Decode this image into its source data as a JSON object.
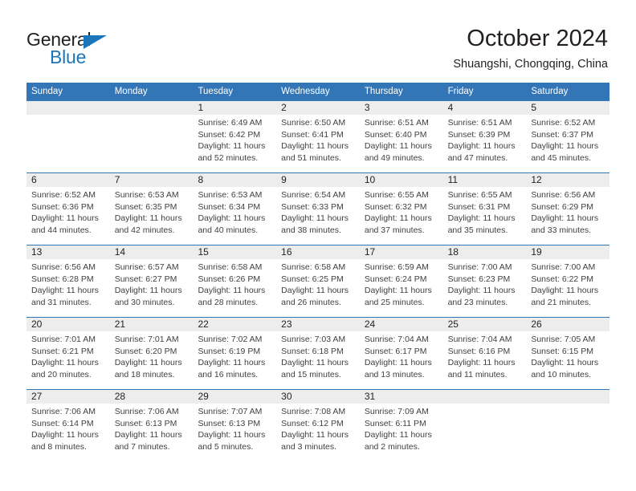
{
  "brand": {
    "name_top": "General",
    "name_bottom": "Blue",
    "color_blue": "#1b75bb",
    "color_dark": "#231f20"
  },
  "header": {
    "title": "October 2024",
    "subtitle": "Shuangshi, Chongqing, China"
  },
  "theme": {
    "header_blue": "#3276b8",
    "daynum_band": "#ededed",
    "text": "#231f20"
  },
  "weekdays": [
    "Sunday",
    "Monday",
    "Tuesday",
    "Wednesday",
    "Thursday",
    "Friday",
    "Saturday"
  ],
  "weeks": [
    [
      {
        "empty": true
      },
      {
        "empty": true
      },
      {
        "day": "1",
        "sunrise": "Sunrise: 6:49 AM",
        "sunset": "Sunset: 6:42 PM",
        "daylight1": "Daylight: 11 hours",
        "daylight2": "and 52 minutes."
      },
      {
        "day": "2",
        "sunrise": "Sunrise: 6:50 AM",
        "sunset": "Sunset: 6:41 PM",
        "daylight1": "Daylight: 11 hours",
        "daylight2": "and 51 minutes."
      },
      {
        "day": "3",
        "sunrise": "Sunrise: 6:51 AM",
        "sunset": "Sunset: 6:40 PM",
        "daylight1": "Daylight: 11 hours",
        "daylight2": "and 49 minutes."
      },
      {
        "day": "4",
        "sunrise": "Sunrise: 6:51 AM",
        "sunset": "Sunset: 6:39 PM",
        "daylight1": "Daylight: 11 hours",
        "daylight2": "and 47 minutes."
      },
      {
        "day": "5",
        "sunrise": "Sunrise: 6:52 AM",
        "sunset": "Sunset: 6:37 PM",
        "daylight1": "Daylight: 11 hours",
        "daylight2": "and 45 minutes."
      }
    ],
    [
      {
        "day": "6",
        "sunrise": "Sunrise: 6:52 AM",
        "sunset": "Sunset: 6:36 PM",
        "daylight1": "Daylight: 11 hours",
        "daylight2": "and 44 minutes."
      },
      {
        "day": "7",
        "sunrise": "Sunrise: 6:53 AM",
        "sunset": "Sunset: 6:35 PM",
        "daylight1": "Daylight: 11 hours",
        "daylight2": "and 42 minutes."
      },
      {
        "day": "8",
        "sunrise": "Sunrise: 6:53 AM",
        "sunset": "Sunset: 6:34 PM",
        "daylight1": "Daylight: 11 hours",
        "daylight2": "and 40 minutes."
      },
      {
        "day": "9",
        "sunrise": "Sunrise: 6:54 AM",
        "sunset": "Sunset: 6:33 PM",
        "daylight1": "Daylight: 11 hours",
        "daylight2": "and 38 minutes."
      },
      {
        "day": "10",
        "sunrise": "Sunrise: 6:55 AM",
        "sunset": "Sunset: 6:32 PM",
        "daylight1": "Daylight: 11 hours",
        "daylight2": "and 37 minutes."
      },
      {
        "day": "11",
        "sunrise": "Sunrise: 6:55 AM",
        "sunset": "Sunset: 6:31 PM",
        "daylight1": "Daylight: 11 hours",
        "daylight2": "and 35 minutes."
      },
      {
        "day": "12",
        "sunrise": "Sunrise: 6:56 AM",
        "sunset": "Sunset: 6:29 PM",
        "daylight1": "Daylight: 11 hours",
        "daylight2": "and 33 minutes."
      }
    ],
    [
      {
        "day": "13",
        "sunrise": "Sunrise: 6:56 AM",
        "sunset": "Sunset: 6:28 PM",
        "daylight1": "Daylight: 11 hours",
        "daylight2": "and 31 minutes."
      },
      {
        "day": "14",
        "sunrise": "Sunrise: 6:57 AM",
        "sunset": "Sunset: 6:27 PM",
        "daylight1": "Daylight: 11 hours",
        "daylight2": "and 30 minutes."
      },
      {
        "day": "15",
        "sunrise": "Sunrise: 6:58 AM",
        "sunset": "Sunset: 6:26 PM",
        "daylight1": "Daylight: 11 hours",
        "daylight2": "and 28 minutes."
      },
      {
        "day": "16",
        "sunrise": "Sunrise: 6:58 AM",
        "sunset": "Sunset: 6:25 PM",
        "daylight1": "Daylight: 11 hours",
        "daylight2": "and 26 minutes."
      },
      {
        "day": "17",
        "sunrise": "Sunrise: 6:59 AM",
        "sunset": "Sunset: 6:24 PM",
        "daylight1": "Daylight: 11 hours",
        "daylight2": "and 25 minutes."
      },
      {
        "day": "18",
        "sunrise": "Sunrise: 7:00 AM",
        "sunset": "Sunset: 6:23 PM",
        "daylight1": "Daylight: 11 hours",
        "daylight2": "and 23 minutes."
      },
      {
        "day": "19",
        "sunrise": "Sunrise: 7:00 AM",
        "sunset": "Sunset: 6:22 PM",
        "daylight1": "Daylight: 11 hours",
        "daylight2": "and 21 minutes."
      }
    ],
    [
      {
        "day": "20",
        "sunrise": "Sunrise: 7:01 AM",
        "sunset": "Sunset: 6:21 PM",
        "daylight1": "Daylight: 11 hours",
        "daylight2": "and 20 minutes."
      },
      {
        "day": "21",
        "sunrise": "Sunrise: 7:01 AM",
        "sunset": "Sunset: 6:20 PM",
        "daylight1": "Daylight: 11 hours",
        "daylight2": "and 18 minutes."
      },
      {
        "day": "22",
        "sunrise": "Sunrise: 7:02 AM",
        "sunset": "Sunset: 6:19 PM",
        "daylight1": "Daylight: 11 hours",
        "daylight2": "and 16 minutes."
      },
      {
        "day": "23",
        "sunrise": "Sunrise: 7:03 AM",
        "sunset": "Sunset: 6:18 PM",
        "daylight1": "Daylight: 11 hours",
        "daylight2": "and 15 minutes."
      },
      {
        "day": "24",
        "sunrise": "Sunrise: 7:04 AM",
        "sunset": "Sunset: 6:17 PM",
        "daylight1": "Daylight: 11 hours",
        "daylight2": "and 13 minutes."
      },
      {
        "day": "25",
        "sunrise": "Sunrise: 7:04 AM",
        "sunset": "Sunset: 6:16 PM",
        "daylight1": "Daylight: 11 hours",
        "daylight2": "and 11 minutes."
      },
      {
        "day": "26",
        "sunrise": "Sunrise: 7:05 AM",
        "sunset": "Sunset: 6:15 PM",
        "daylight1": "Daylight: 11 hours",
        "daylight2": "and 10 minutes."
      }
    ],
    [
      {
        "day": "27",
        "sunrise": "Sunrise: 7:06 AM",
        "sunset": "Sunset: 6:14 PM",
        "daylight1": "Daylight: 11 hours",
        "daylight2": "and 8 minutes."
      },
      {
        "day": "28",
        "sunrise": "Sunrise: 7:06 AM",
        "sunset": "Sunset: 6:13 PM",
        "daylight1": "Daylight: 11 hours",
        "daylight2": "and 7 minutes."
      },
      {
        "day": "29",
        "sunrise": "Sunrise: 7:07 AM",
        "sunset": "Sunset: 6:13 PM",
        "daylight1": "Daylight: 11 hours",
        "daylight2": "and 5 minutes."
      },
      {
        "day": "30",
        "sunrise": "Sunrise: 7:08 AM",
        "sunset": "Sunset: 6:12 PM",
        "daylight1": "Daylight: 11 hours",
        "daylight2": "and 3 minutes."
      },
      {
        "day": "31",
        "sunrise": "Sunrise: 7:09 AM",
        "sunset": "Sunset: 6:11 PM",
        "daylight1": "Daylight: 11 hours",
        "daylight2": "and 2 minutes."
      },
      {
        "empty": true
      },
      {
        "empty": true
      }
    ]
  ]
}
